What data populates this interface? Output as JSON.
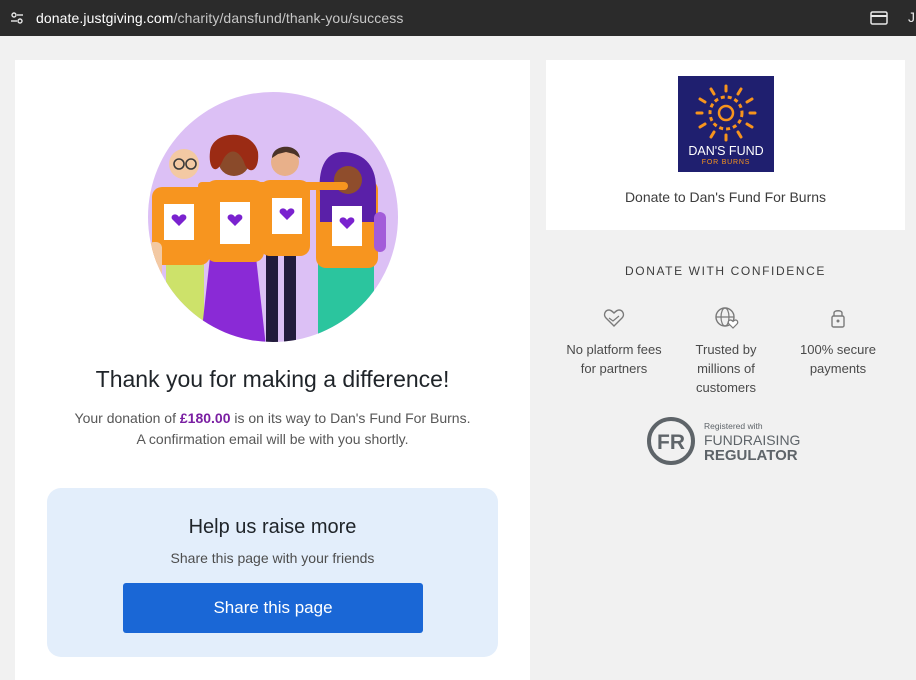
{
  "browser": {
    "url_host": "donate.justgiving.com",
    "url_path": "/charity/dansfund/thank-you/success",
    "cut_glyph": "J"
  },
  "main": {
    "title": "Thank you for making a difference!",
    "donation_prefix": "Your donation of ",
    "donation_amount": "£180.00",
    "donation_suffix": " is on its way to Dan's Fund For Burns.",
    "confirmation": "A confirmation email will be with you shortly.",
    "share": {
      "title": "Help us raise more",
      "subtitle": "Share this page with your friends",
      "button_label": "Share this page"
    }
  },
  "charity": {
    "logo_line1": "DAN'S FUND",
    "logo_line2": "FOR BURNS",
    "name": "Donate to Dan's Fund For Burns"
  },
  "confidence": {
    "title": "DONATE WITH CONFIDENCE",
    "features": [
      {
        "line1": "No platform fees",
        "line2": "for partners",
        "line3": "",
        "icon": "heart-hand-icon"
      },
      {
        "line1": "Trusted by",
        "line2": "millions of",
        "line3": "customers",
        "icon": "globe-heart-icon"
      },
      {
        "line1": "100% secure",
        "line2": "payments",
        "line3": "",
        "icon": "lock-icon"
      }
    ]
  },
  "regulator": {
    "badge": "FR",
    "registered": "Registered with",
    "line1": "FUNDRAISING",
    "line2": "REGULATOR"
  },
  "colors": {
    "address_bar": "#2b2b2b",
    "page_bg": "#f1f1f1",
    "share_box": "#e3eefb",
    "share_button": "#1a67d6",
    "amount": "#7a1fa2",
    "charity_logo_bg": "#1f1f6f",
    "charity_logo_orange": "#f7941d",
    "illustration_bg": "#dcc0f5"
  }
}
